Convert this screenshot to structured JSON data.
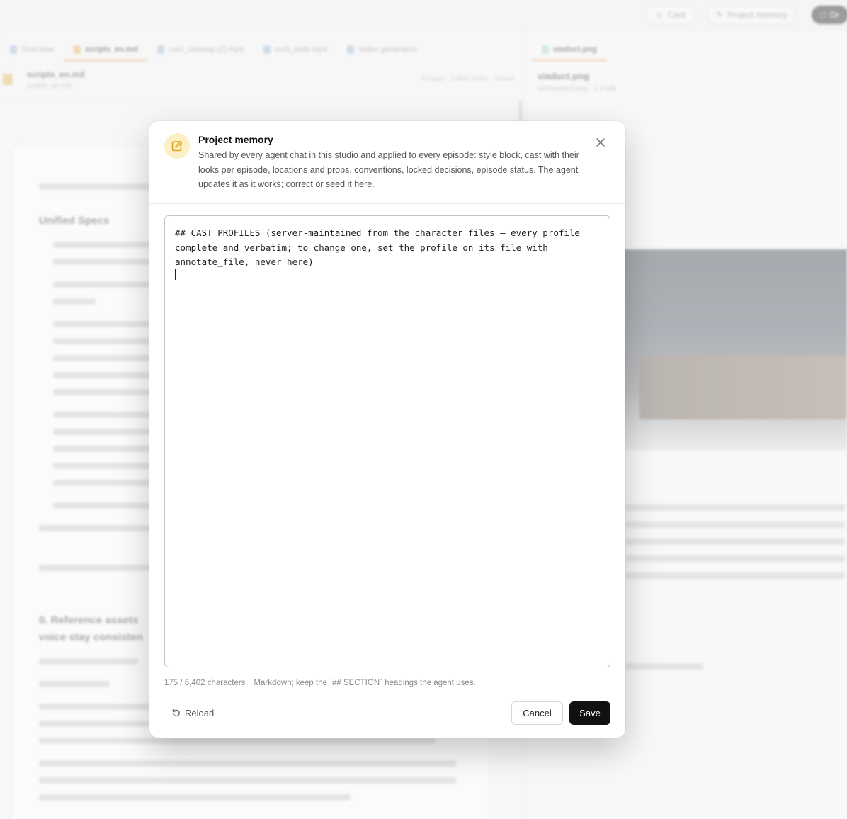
{
  "header": {
    "buttons": [
      {
        "label": "Cast",
        "icon": "user-icon"
      },
      {
        "label": "Project memory",
        "icon": "memory-icon"
      },
      {
        "label": "Dr",
        "icon": "file-icon"
      }
    ]
  },
  "tabs": [
    {
      "label": "Overview"
    },
    {
      "label": "scripts_en.md",
      "active": true
    },
    {
      "label": "cut2_closeup (2).mp4"
    },
    {
      "label": "cut3_wide.mp4"
    },
    {
      "label": "Video generation"
    }
  ],
  "right_tab": {
    "label": "viaduct.png",
    "title": "viaduct.png",
    "sub": "refs/viaduct.png · 1.9 MB"
  },
  "file": {
    "title": "scripts_en.md",
    "sub": "scripts_en.md",
    "meta": "5 maps · 2,804 chars · Saved"
  },
  "doc": {
    "heading1": "Unified Specs",
    "heading2": "0. Reference assets",
    "heading2b": "voice stay consisten"
  },
  "modal": {
    "title": "Project memory",
    "description": "Shared by every agent chat in this studio and applied to every episode: style block, cast with their looks per episode, locations and props, conventions, locked decisions, episode status. The agent updates it as it works; correct or seed it here.",
    "close_label": "×",
    "editor_value": "## CAST PROFILES (server-maintained from the character files — every profile complete and verbatim; to change one, set the profile on its file with annotate_file, never here)\n",
    "char_count": "175 / 6,402 characters",
    "hint": "Markdown; keep the `## SECTION` headings the agent uses.",
    "reload_label": "Reload",
    "cancel_label": "Cancel",
    "save_label": "Save"
  },
  "colors": {
    "accent": "#111111",
    "badge_bg": "#fdf0c6",
    "badge_icon": "#d9a21b",
    "tab_underline": "#e08a3c"
  }
}
